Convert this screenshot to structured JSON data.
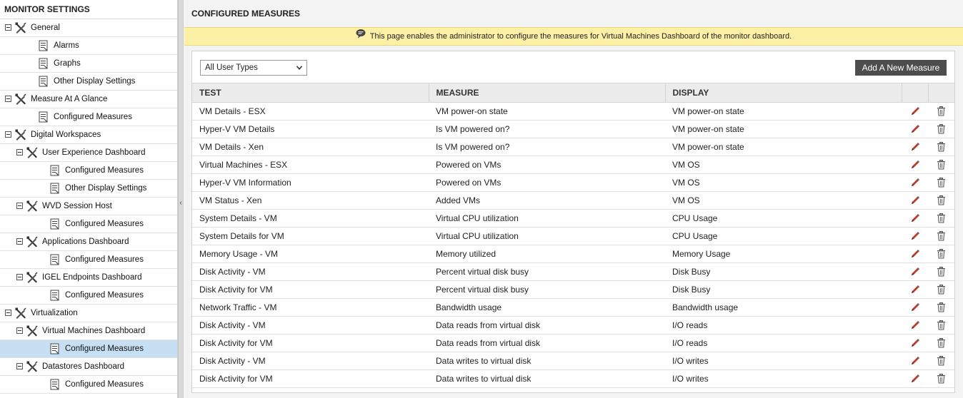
{
  "sidebar": {
    "title": "MONITOR SETTINGS",
    "items": [
      {
        "label": "General",
        "level": 0,
        "type": "group"
      },
      {
        "label": "Alarms",
        "level": 1,
        "type": "page"
      },
      {
        "label": "Graphs",
        "level": 1,
        "type": "page"
      },
      {
        "label": "Other Display Settings",
        "level": 1,
        "type": "page"
      },
      {
        "label": "Measure At A Glance",
        "level": 0,
        "type": "group"
      },
      {
        "label": "Configured Measures",
        "level": 1,
        "type": "page"
      },
      {
        "label": "Digital Workspaces",
        "level": 0,
        "type": "group"
      },
      {
        "label": "User Experience Dashboard",
        "level": 1,
        "type": "group"
      },
      {
        "label": "Configured Measures",
        "level": 2,
        "type": "page"
      },
      {
        "label": "Other Display Settings",
        "level": 2,
        "type": "page"
      },
      {
        "label": "WVD Session Host",
        "level": 1,
        "type": "group"
      },
      {
        "label": "Configured Measures",
        "level": 2,
        "type": "page"
      },
      {
        "label": "Applications Dashboard",
        "level": 1,
        "type": "group"
      },
      {
        "label": "Configured Measures",
        "level": 2,
        "type": "page"
      },
      {
        "label": "IGEL Endpoints Dashboard",
        "level": 1,
        "type": "group"
      },
      {
        "label": "Configured Measures",
        "level": 2,
        "type": "page"
      },
      {
        "label": "Virtualization",
        "level": 0,
        "type": "group"
      },
      {
        "label": "Virtual Machines Dashboard",
        "level": 1,
        "type": "group"
      },
      {
        "label": "Configured Measures",
        "level": 2,
        "type": "page",
        "selected": true
      },
      {
        "label": "Datastores Dashboard",
        "level": 1,
        "type": "group"
      },
      {
        "label": "Configured Measures",
        "level": 2,
        "type": "page"
      }
    ]
  },
  "main": {
    "title": "CONFIGURED MEASURES",
    "notice": "This page enables the administrator to configure the measures for Virtual Machines Dashboard of the monitor dashboard.",
    "user_type_select": "All User Types",
    "add_button": "Add A New Measure",
    "columns": [
      "TEST",
      "MEASURE",
      "DISPLAY"
    ],
    "rows": [
      [
        "VM Details - ESX",
        "VM power-on state",
        "VM power-on state"
      ],
      [
        "Hyper-V VM Details",
        "Is VM powered on?",
        "VM power-on state"
      ],
      [
        "VM Details - Xen",
        "Is VM powered on?",
        "VM power-on state"
      ],
      [
        "Virtual Machines - ESX",
        "Powered on VMs",
        "VM OS"
      ],
      [
        "Hyper-V VM Information",
        "Powered on VMs",
        "VM OS"
      ],
      [
        "VM Status - Xen",
        "Added VMs",
        "VM OS"
      ],
      [
        "System Details - VM",
        "Virtual CPU utilization",
        "CPU Usage"
      ],
      [
        "System Details for VM",
        "Virtual CPU utilization",
        "CPU Usage"
      ],
      [
        "Memory Usage - VM",
        "Memory utilized",
        "Memory Usage"
      ],
      [
        "Disk Activity - VM",
        "Percent virtual disk busy",
        "Disk Busy"
      ],
      [
        "Disk Activity for VM",
        "Percent virtual disk busy",
        "Disk Busy"
      ],
      [
        "Network Traffic - VM",
        "Bandwidth usage",
        "Bandwidth usage"
      ],
      [
        "Disk Activity - VM",
        "Data reads from virtual disk",
        "I/O reads"
      ],
      [
        "Disk Activity for VM",
        "Data reads from virtual disk",
        "I/O reads"
      ],
      [
        "Disk Activity - VM",
        "Data writes to virtual disk",
        "I/O writes"
      ],
      [
        "Disk Activity for VM",
        "Data writes to virtual disk",
        "I/O writes"
      ]
    ]
  },
  "colors": {
    "notice_bg": "#fcf0a6",
    "selected_bg": "#c7dff2",
    "button_bg": "#4d4d4d",
    "edit_icon": "#c0392b"
  }
}
